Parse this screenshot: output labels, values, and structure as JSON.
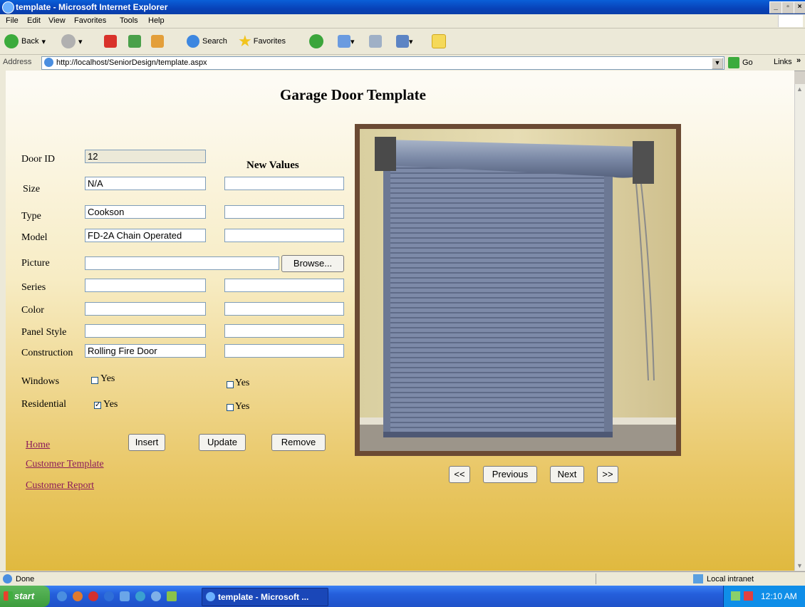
{
  "window": {
    "title": "template - Microsoft Internet Explorer"
  },
  "menu": [
    "File",
    "Edit",
    "View",
    "Favorites",
    "Tools",
    "Help"
  ],
  "toolbar": {
    "back": "Back",
    "search": "Search",
    "favorites": "Favorites"
  },
  "address": {
    "label": "Address",
    "url": "http://localhost/SeniorDesign/template.aspx",
    "go": "Go",
    "links": "Links"
  },
  "page": {
    "title": "Garage Door Template",
    "new_values_header": "New Values",
    "fields": {
      "door_id": {
        "label": "Door ID",
        "value": "12"
      },
      "size": {
        "label": "Size",
        "value": "N/A",
        "new": ""
      },
      "type": {
        "label": "Type",
        "value": "Cookson",
        "new": ""
      },
      "model": {
        "label": "Model",
        "value": "FD-2A Chain Operated",
        "new": ""
      },
      "picture": {
        "label": "Picture",
        "value": "",
        "browse": "Browse..."
      },
      "series": {
        "label": "Series",
        "value": "",
        "new": ""
      },
      "color": {
        "label": "Color",
        "value": "",
        "new": ""
      },
      "panel_style": {
        "label": "Panel Style",
        "value": "",
        "new": ""
      },
      "construction": {
        "label": "Construction",
        "value": "Rolling Fire Door",
        "new": ""
      }
    },
    "windows": {
      "label": "Windows",
      "current": "Yes",
      "new": "Yes",
      "current_checked": false,
      "new_checked": false
    },
    "residential": {
      "label": "Residential",
      "current": "Yes",
      "new": "Yes",
      "current_checked": true,
      "new_checked": false
    },
    "buttons": {
      "insert": "Insert",
      "update": "Update",
      "remove": "Remove"
    },
    "links": {
      "home": "Home",
      "customer_template": "Customer Template",
      "customer_report": "Customer Report"
    },
    "nav": {
      "first": "<<",
      "previous": "Previous",
      "next": "Next",
      "last": ">>"
    }
  },
  "status": {
    "text": "Done",
    "zone": "Local intranet"
  },
  "taskbar": {
    "start": "start",
    "item": "template - Microsoft ...",
    "clock": "12:10 AM"
  }
}
